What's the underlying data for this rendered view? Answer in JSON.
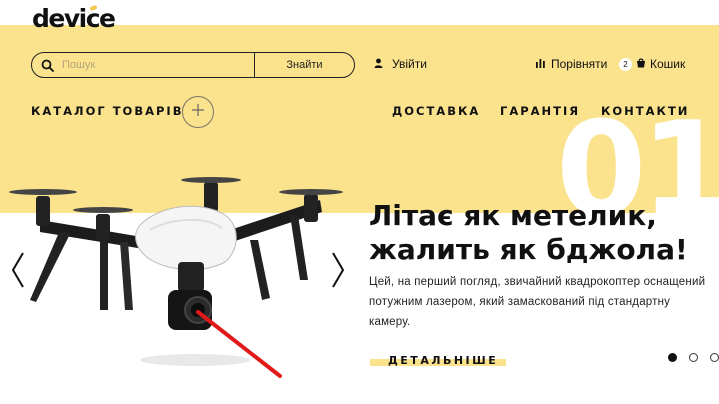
{
  "brand": {
    "logo_text": "device"
  },
  "search": {
    "placeholder": "Пошук",
    "button_label": "Знайти"
  },
  "header": {
    "login_label": "Увійти",
    "compare_label": "Порівняти",
    "cart_count": "2",
    "cart_label": "Кошик"
  },
  "nav": {
    "catalog_label": "КАТАЛОГ ТОВАРІВ",
    "items": [
      "ДОСТАВКА",
      "ГАРАНТІЯ",
      "КОНТАКТИ"
    ]
  },
  "slider": {
    "number": "01",
    "headline_line1": "Літає як метелик,",
    "headline_line2": "жалить як бджола!",
    "description": "Цей, на перший погляд, звичайний квадрокоптер оснащений потужним лазером, який замаскований під стандартну камеру.",
    "more_label": "ДЕТАЛЬНІШЕ",
    "active_slide": 1,
    "slide_count": 3
  },
  "colors": {
    "accent_yellow": "#fbe28d",
    "laser_red": "#e01919",
    "text_dark": "#111111"
  },
  "icons": [
    "search-icon",
    "user-icon",
    "compare-icon",
    "cart-icon",
    "plus-icon",
    "arrow-left-icon",
    "arrow-right-icon"
  ]
}
